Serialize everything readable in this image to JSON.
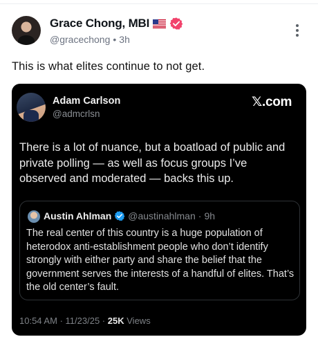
{
  "post": {
    "author_name": "Grace Chong, MBI",
    "flag_icon": "us-flag-icon",
    "verified_icon": "verified-badge-icon",
    "verified_color": "#f2436c",
    "handle": "@gracechong",
    "separator": "•",
    "time": "3h",
    "text": "This is what elites continue to not get."
  },
  "embed": {
    "brand": "𝕏.com",
    "author_name": "Adam Carlson",
    "handle": "@admcrlsn",
    "text": "There is a lot of nuance, but a boatload of public and private polling — as well as focus groups I’ve observed and moderated — backs this up.",
    "quote": {
      "author_name": "Austin Ahlman",
      "verified_color": "#1d9bf0",
      "handle": "@austinahlman",
      "separator": "·",
      "time": "9h",
      "text": "The real center of this country is a huge population of heterodox anti-establishment people who don’t identify strongly with either party and share the belief that the government serves the interests of a handful of elites. That’s the old center’s fault."
    },
    "footer": {
      "time": "10:54 AM",
      "separator": "·",
      "date": "11/23/25",
      "separator2": "·",
      "views_count": "25K",
      "views_label": "Views"
    }
  }
}
